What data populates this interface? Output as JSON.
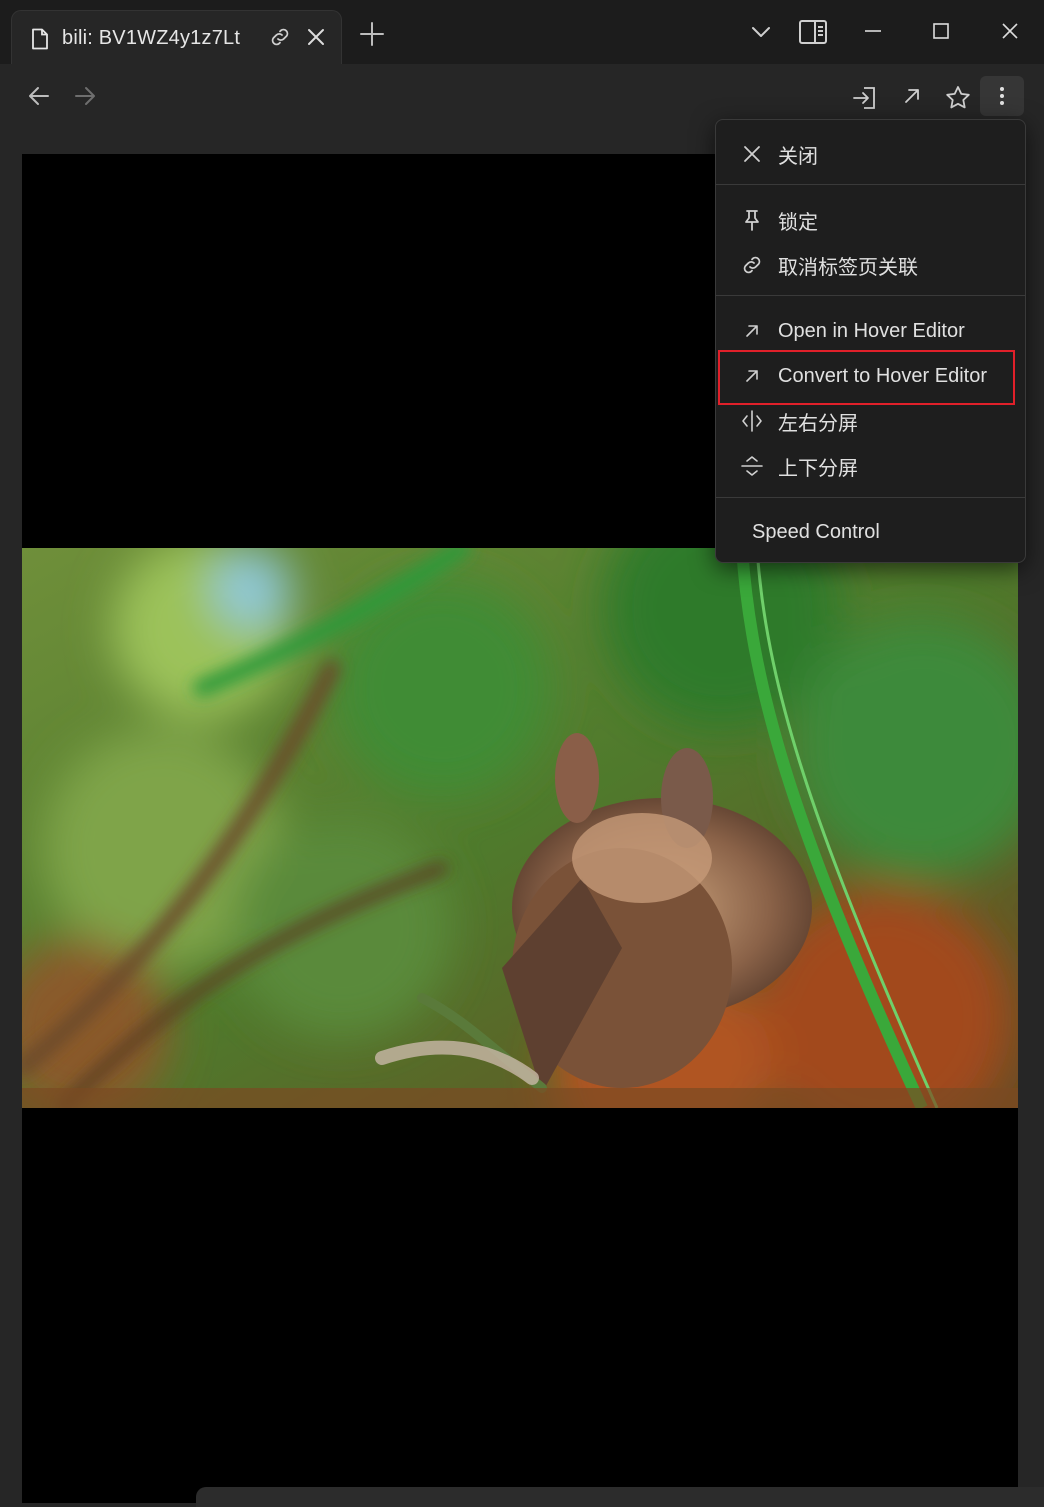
{
  "tab": {
    "title": "bili: BV1WZ4y1z7Lt"
  },
  "icons": {
    "file": "file-icon",
    "link": "link-icon",
    "close": "close-icon",
    "plus": "plus-icon",
    "chevron": "chevron-down-icon",
    "sidebar": "sidebar-toggle-icon",
    "minimize": "minimize-icon",
    "maximize": "maximize-icon",
    "back": "arrow-left-icon",
    "forward": "arrow-right-icon",
    "import": "import-icon",
    "open_external": "arrow-up-right-icon",
    "star": "star-icon",
    "more": "more-vertical-icon"
  },
  "menu": {
    "close_label": "关闭",
    "lock_label": "锁定",
    "unlink_label": "取消标签页关联",
    "open_hover_label": "Open in Hover Editor",
    "convert_hover_label": "Convert to Hover Editor",
    "split_lr_label": "左右分屏",
    "split_tb_label": "上下分屏",
    "speed_label": "Speed Control"
  },
  "colors": {
    "highlight": "#e0202a",
    "menu_bg": "#1e1e1e",
    "app_bg": "#262626"
  }
}
